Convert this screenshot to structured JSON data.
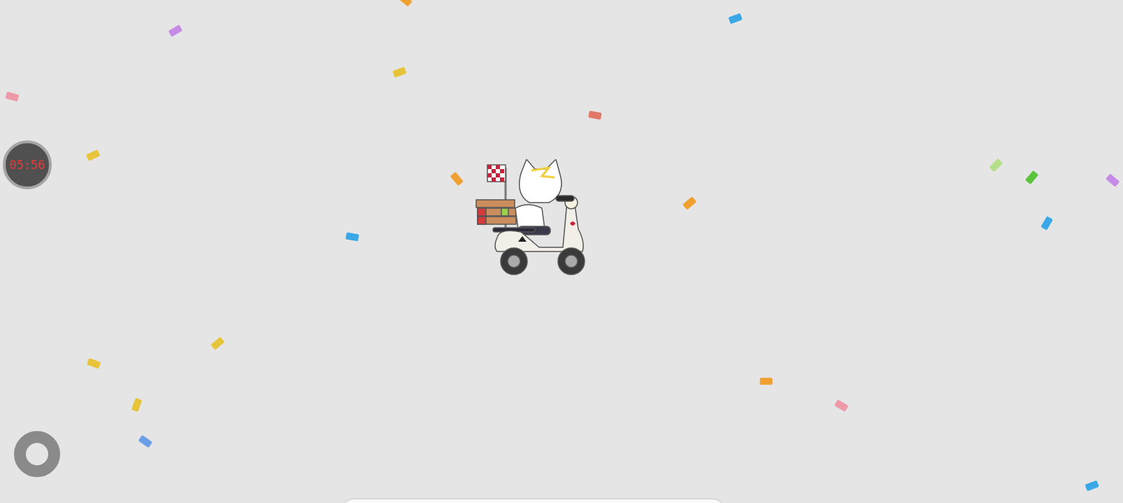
{
  "timer": {
    "text": "05:56"
  }
}
